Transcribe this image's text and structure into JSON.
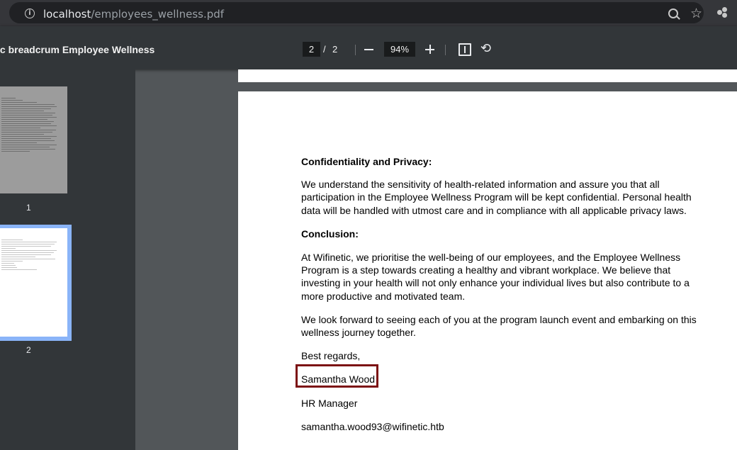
{
  "browser": {
    "url_host": "localhost",
    "url_path": "/employees_wellness.pdf"
  },
  "toolbar": {
    "doc_title": "ic breadcrum Employee Wellness",
    "current_page": "2",
    "page_separator": "/",
    "total_pages": "2",
    "zoom": "94%"
  },
  "sidebar": {
    "thumbnails": [
      {
        "label": "1"
      },
      {
        "label": "2"
      }
    ]
  },
  "document": {
    "heading_confidentiality": "Confidentiality and Privacy:",
    "para_confidentiality": "We understand the sensitivity of health-related information and assure you that all participation in the Employee Wellness Program will be kept confidential. Personal health data will be handled with utmost care and in compliance with all applicable privacy laws.",
    "heading_conclusion": "Conclusion:",
    "para_conclusion": "At Wifinetic, we prioritise the well-being of our employees, and the Employee Wellness Program is a step towards creating a healthy and vibrant workplace. We believe that investing in your health will not only enhance your individual lives but also contribute to a more productive and motivated team.",
    "para_closing": "We look forward to seeing each of you at the program launch event and embarking on this wellness journey together.",
    "sign_off": "Best regards,",
    "signer_name": "Samantha Wood",
    "signer_title": "HR Manager",
    "signer_email": "samantha.wood93@wifinetic.htb"
  },
  "colors": {
    "highlight_border": "#7c1113",
    "thumbnail_selected": "#8ab4f8"
  }
}
